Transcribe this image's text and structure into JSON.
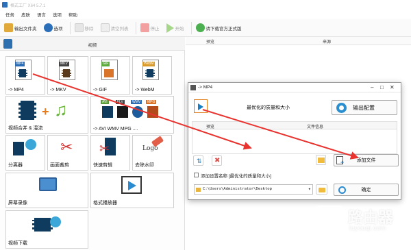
{
  "window": {
    "title": "格式工厂 X64 5.7.1"
  },
  "menu": [
    "任务",
    "皮肤",
    "语言",
    "选项",
    "帮助"
  ],
  "toolbar": {
    "output_folder": "输出文件夹",
    "options": "选项",
    "remove": "移除",
    "clear_list": "清空列表",
    "stop": "停止",
    "start": "开始",
    "download": "请下载官方正式版"
  },
  "left": {
    "category": "视频",
    "tiles": [
      {
        "label": "-> MP4",
        "tag": "MP4"
      },
      {
        "label": "-> MKV",
        "tag": "MKV"
      },
      {
        "label": "-> GIF",
        "tag": "GIF"
      },
      {
        "label": "-> WebM",
        "tag": "WebM"
      },
      {
        "label": "视频合并 & 混流"
      },
      {
        "label": "-> AVI WMV MPG ....",
        "tags": [
          "AVI",
          "FLV",
          "WMV",
          "MPG"
        ]
      },
      {
        "label": "分离器"
      },
      {
        "label": "画面裁剪"
      },
      {
        "label": "快速剪辑"
      },
      {
        "label": "去除水印",
        "logo_text": "Logo"
      },
      {
        "label": "屏幕录像"
      },
      {
        "label": "格式播放器"
      },
      {
        "label": "视频下载"
      }
    ]
  },
  "right": {
    "col_preview": "预览",
    "col_source": "来源"
  },
  "dialog": {
    "title": "-> MP4",
    "quality": "最优化的质量和大小",
    "output_config": "输出配置",
    "col_preview": "预览",
    "col_fileinfo": "文件信息",
    "add_file": "添加文件",
    "add_setting_name": "添加设置名称 [最优化的质量和大小]",
    "path": "C:\\Users\\Administrator\\Desktop",
    "ok": "确定"
  },
  "watermark": {
    "title": "路由器",
    "subtitle": "luyouqi.com"
  },
  "colors": {
    "arrow": "#e8332f",
    "accent": "#2a8bd1",
    "folder": "#f1bb3d"
  }
}
